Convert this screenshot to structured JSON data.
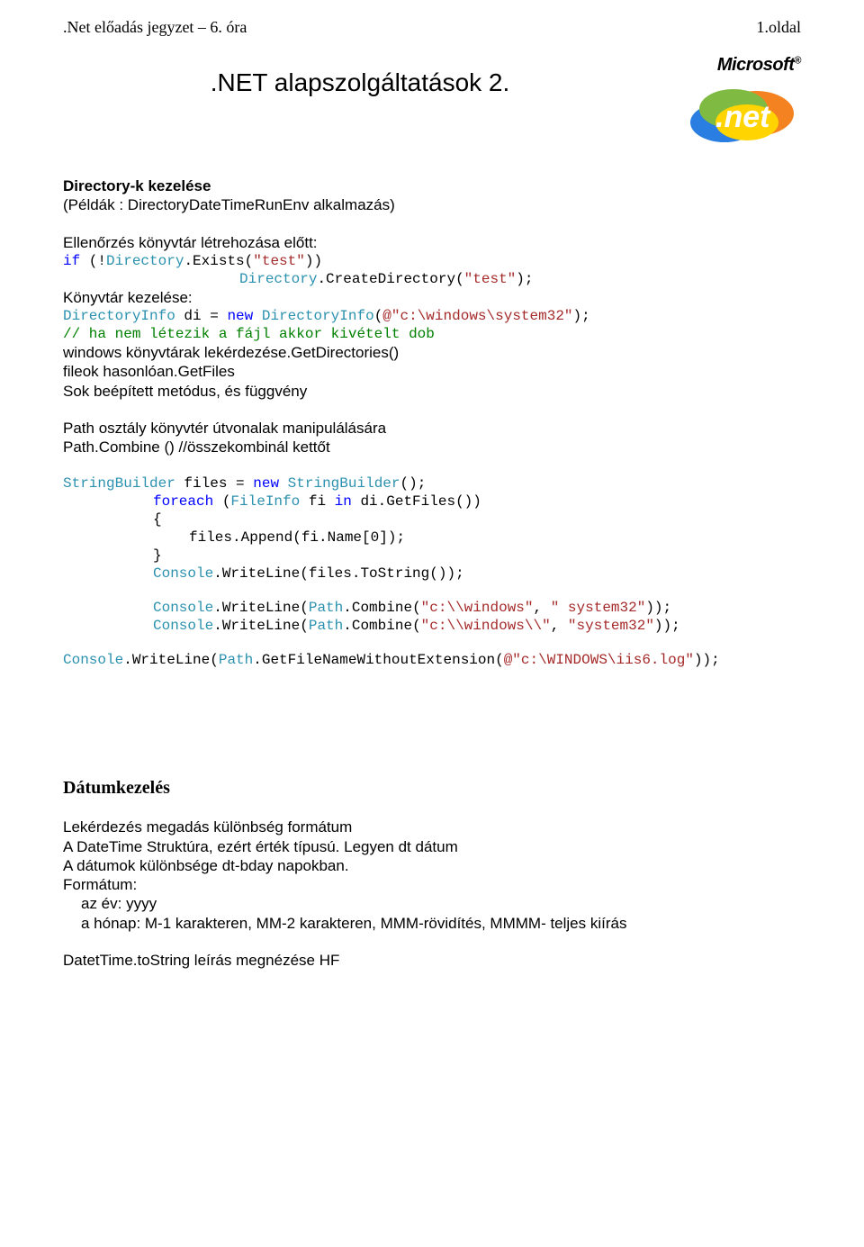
{
  "header": {
    "left": ".Net előadás jegyzet – 6. óra",
    "right": "1.oldal"
  },
  "title": ".NET alapszolgáltatások 2.",
  "logo": {
    "text": "Microsoft",
    "suffix": "®",
    "net": ".net"
  },
  "s1": {
    "h": "Directory-k kezelése",
    "sub": "(Példák : DirectoryDateTimeRunEnv alkalmazás)",
    "line1": "Ellenőrzés könyvtár létrehozása előtt:",
    "c1": {
      "a": "if",
      "b": " (!",
      "c": "Directory",
      "d": ".Exists(",
      "e": "\"test\"",
      "f": "))"
    },
    "c2": {
      "a": "Directory",
      "b": ".CreateDirectory(",
      "c": "\"test\"",
      "d": ");"
    },
    "line2": "Könyvtár kezelése:",
    "c3": {
      "a": "DirectoryInfo",
      "b": " di = ",
      "c": "new",
      "d": " ",
      "e": "DirectoryInfo",
      "f": "(",
      "g": "@\"c:\\windows\\system32\"",
      "h": ");"
    },
    "c4": "// ha nem létezik a fájl akkor kivételt dob",
    "line3": "windows könyvtárak lekérdezése.GetDirectories()",
    "line4": "fileok hasonlóan.GetFiles",
    "line5": "Sok beépített metódus, és függvény",
    "line6": "Path osztály könyvtér útvonalak manipulálására",
    "line7": "Path.Combine ()  //összekombinál kettőt",
    "c5": {
      "a": "StringBuilder",
      "b": " files = ",
      "c": "new",
      "d": " ",
      "e": "StringBuilder",
      "f": "();"
    },
    "c6": {
      "a": "foreach",
      "b": " (",
      "c": "FileInfo",
      "d": " fi ",
      "e": "in",
      "f": " di.GetFiles())"
    },
    "c7": "{",
    "c8": {
      "a": "files.Append(fi.Name[0]);"
    },
    "c9": "}",
    "c10": {
      "a": "Console",
      "b": ".WriteLine(files.ToString());"
    },
    "c11": {
      "a": "Console",
      "b": ".WriteLine(",
      "c": "Path",
      "d": ".Combine(",
      "e": "\"c:\\\\windows\"",
      "f": ", ",
      "g": "\" system32\"",
      "h": "));"
    },
    "c12": {
      "a": "Console",
      "b": ".WriteLine(",
      "c": "Path",
      "d": ".Combine(",
      "e": "\"c:\\\\windows\\\\\"",
      "f": ", ",
      "g": "\"system32\"",
      "h": "));"
    },
    "c13": {
      "a": "Console",
      "b": ".WriteLine(",
      "c": "Path",
      "d": ".GetFileNameWithoutExtension(",
      "e": "@\"c:\\WINDOWS\\iis6.log\"",
      "f": "));"
    }
  },
  "s2": {
    "h": "Dátumkezelés",
    "l1": "Lekérdezés megadás különbség formátum",
    "l2": "A DateTime Struktúra, ezért érték típusú. Legyen dt dátum",
    "l3": "A dátumok különbsége dt-bday napokban.",
    "l4": "Formátum:",
    "l5": "az év: yyyy",
    "l6": "a hónap: M-1 karakteren, MM-2 karakteren, MMM-rövidítés, MMMM- teljes kiírás",
    "l7": "DatetTime.toString leírás megnézése HF"
  }
}
